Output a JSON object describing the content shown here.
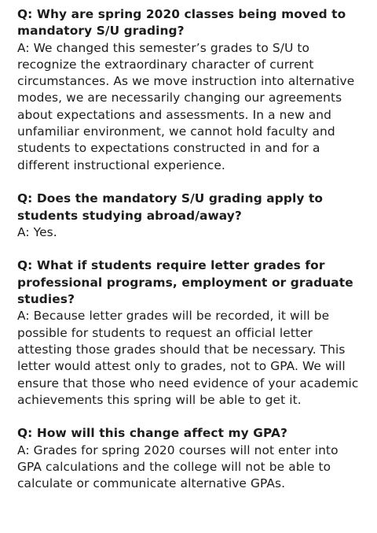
{
  "faqs": [
    {
      "question": "Q: Why are spring 2020 classes being moved to mandatory S/U grading?",
      "answer": "A: We changed this semester’s grades to S/U to recognize the extraordinary character of current circumstances. As we move instruction into alternative modes, we are necessarily changing our agreements about expectations and assessments. In a new and unfamiliar environment, we cannot hold faculty and students to expectations constructed in and for a different instructional experience."
    },
    {
      "question": "Q: Does the mandatory S/U grading apply to students studying abroad/away?",
      "answer": "A: Yes."
    },
    {
      "question": "Q: What if students require letter grades for professional programs, employment or graduate studies?",
      "answer": "A: Because letter grades will be recorded, it will be possible for students to request an official letter attesting those grades should that be necessary. This letter would attest only to grades, not to GPA. We will ensure that those who need evidence of your academic achievements this spring will be able to get it."
    },
    {
      "question": "Q: How will this change affect my GPA?",
      "answer": "A: Grades for spring 2020 courses will not enter into GPA calculations and the college will not be able to calculate or communicate alternative GPAs."
    }
  ]
}
